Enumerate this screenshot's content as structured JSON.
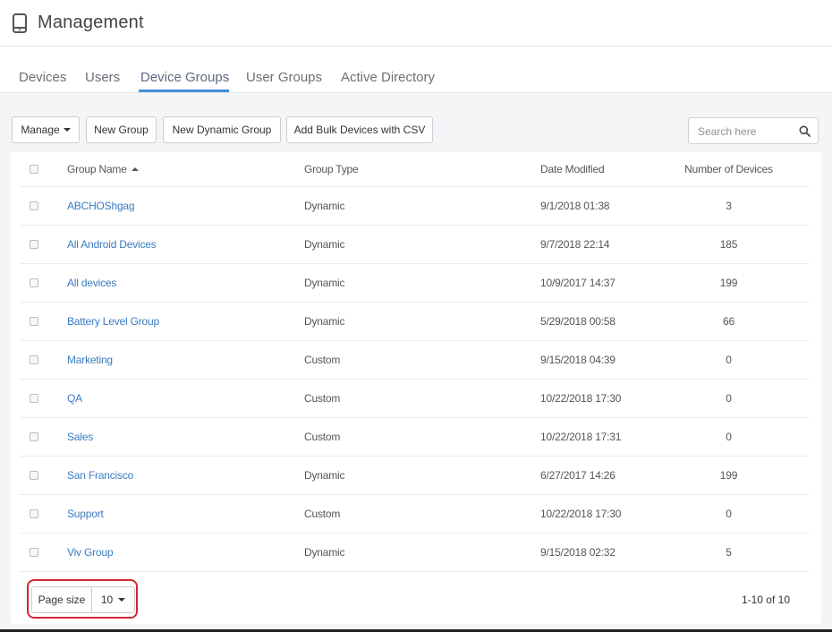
{
  "header": {
    "title": "Management",
    "icon": "phone-icon"
  },
  "tabs": [
    {
      "label": "Devices",
      "active": false
    },
    {
      "label": "Users",
      "active": false
    },
    {
      "label": "Device Groups",
      "active": true
    },
    {
      "label": "User Groups",
      "active": false
    },
    {
      "label": "Active Directory",
      "active": false
    }
  ],
  "toolbar": {
    "manage_label": "Manage",
    "new_group_label": "New Group",
    "new_dynamic_group_label": "New Dynamic Group",
    "bulk_csv_label": "Add Bulk Devices with CSV",
    "search_placeholder": "Search here",
    "search_value": ""
  },
  "table": {
    "columns": [
      "Group Name",
      "Group Type",
      "Date Modified",
      "Number of Devices"
    ],
    "sorted_column": "Group Name",
    "sort_direction": "ascending",
    "rows": [
      {
        "name": "ABCHOShgag",
        "type": "Dynamic",
        "date": "9/1/2018 01:38",
        "devices": "3"
      },
      {
        "name": "All Android Devices",
        "type": "Dynamic",
        "date": "9/7/2018 22:14",
        "devices": "185"
      },
      {
        "name": "All devices",
        "type": "Dynamic",
        "date": "10/9/2017 14:37",
        "devices": "199"
      },
      {
        "name": "Battery Level Group",
        "type": "Dynamic",
        "date": "5/29/2018 00:58",
        "devices": "66"
      },
      {
        "name": "Marketing",
        "type": "Custom",
        "date": "9/15/2018 04:39",
        "devices": "0"
      },
      {
        "name": "QA",
        "type": "Custom",
        "date": "10/22/2018 17:30",
        "devices": "0"
      },
      {
        "name": "Sales",
        "type": "Custom",
        "date": "10/22/2018 17:31",
        "devices": "0"
      },
      {
        "name": "San Francisco",
        "type": "Dynamic",
        "date": "6/27/2017 14:26",
        "devices": "199"
      },
      {
        "name": "Support",
        "type": "Custom",
        "date": "10/22/2018 17:30",
        "devices": "0"
      },
      {
        "name": "Viv Group",
        "type": "Dynamic",
        "date": "9/15/2018 02:32",
        "devices": "5"
      }
    ]
  },
  "pagination": {
    "page_size_label": "Page size",
    "page_size_value": "10",
    "range_text": "1-10 of 10"
  },
  "colors": {
    "accent": "#3f8fd6",
    "link": "#3a7bc0",
    "highlight": "#d4262f",
    "background": "#f4f5f7"
  }
}
